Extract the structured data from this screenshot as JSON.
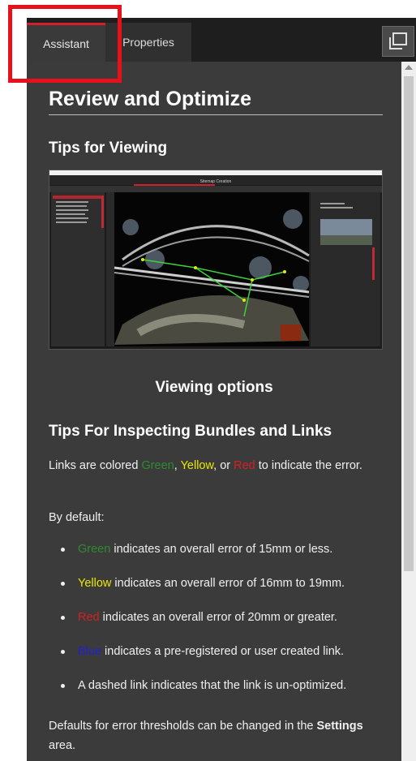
{
  "tabs": [
    {
      "label": "Assistant"
    },
    {
      "label": "Properties"
    }
  ],
  "content": {
    "title": "Review and Optimize",
    "tips_viewing_heading": "Tips for Viewing",
    "screenshot_window_title": "Sitemap Creation",
    "viewing_options_caption": "Viewing options",
    "inspect_heading": "Tips For Inspecting Bundles and Links",
    "links_colored": {
      "prefix": "Links are colored ",
      "green": "Green",
      "sep1": ", ",
      "yellow": "Yellow",
      "sep2": ", or ",
      "red": "Red",
      "suffix": " to indicate the error."
    },
    "by_default": "By default:",
    "bullets": [
      {
        "colored": "Green",
        "color": "green",
        "text": " indicates an overall error of 15mm or less."
      },
      {
        "colored": "Yellow",
        "color": "yellow",
        "text": " indicates an overall error of 16mm to 19mm."
      },
      {
        "colored": "Red",
        "color": "red",
        "text": " indicates an overall error of 20mm or greater."
      },
      {
        "colored": "Blue",
        "color": "blue",
        "text": " indicates a pre-registered or user created link."
      },
      {
        "colored": "",
        "color": "",
        "text": "A dashed link indicates that the link is un-optimized."
      }
    ],
    "defaults": {
      "prefix": "Defaults for error thresholds can be changed in the ",
      "bold": "Settings",
      "suffix": " area."
    }
  },
  "colors": {
    "accent": "#d21f2b",
    "green": "#2f8a2f",
    "yellow": "#e8e800",
    "red": "#d42020",
    "blue": "#2020d8",
    "annotation_box": "#e8101a"
  },
  "icons": {
    "maximize": "window-maximize-icon",
    "scroll_up": "scroll-up-arrow-icon"
  }
}
